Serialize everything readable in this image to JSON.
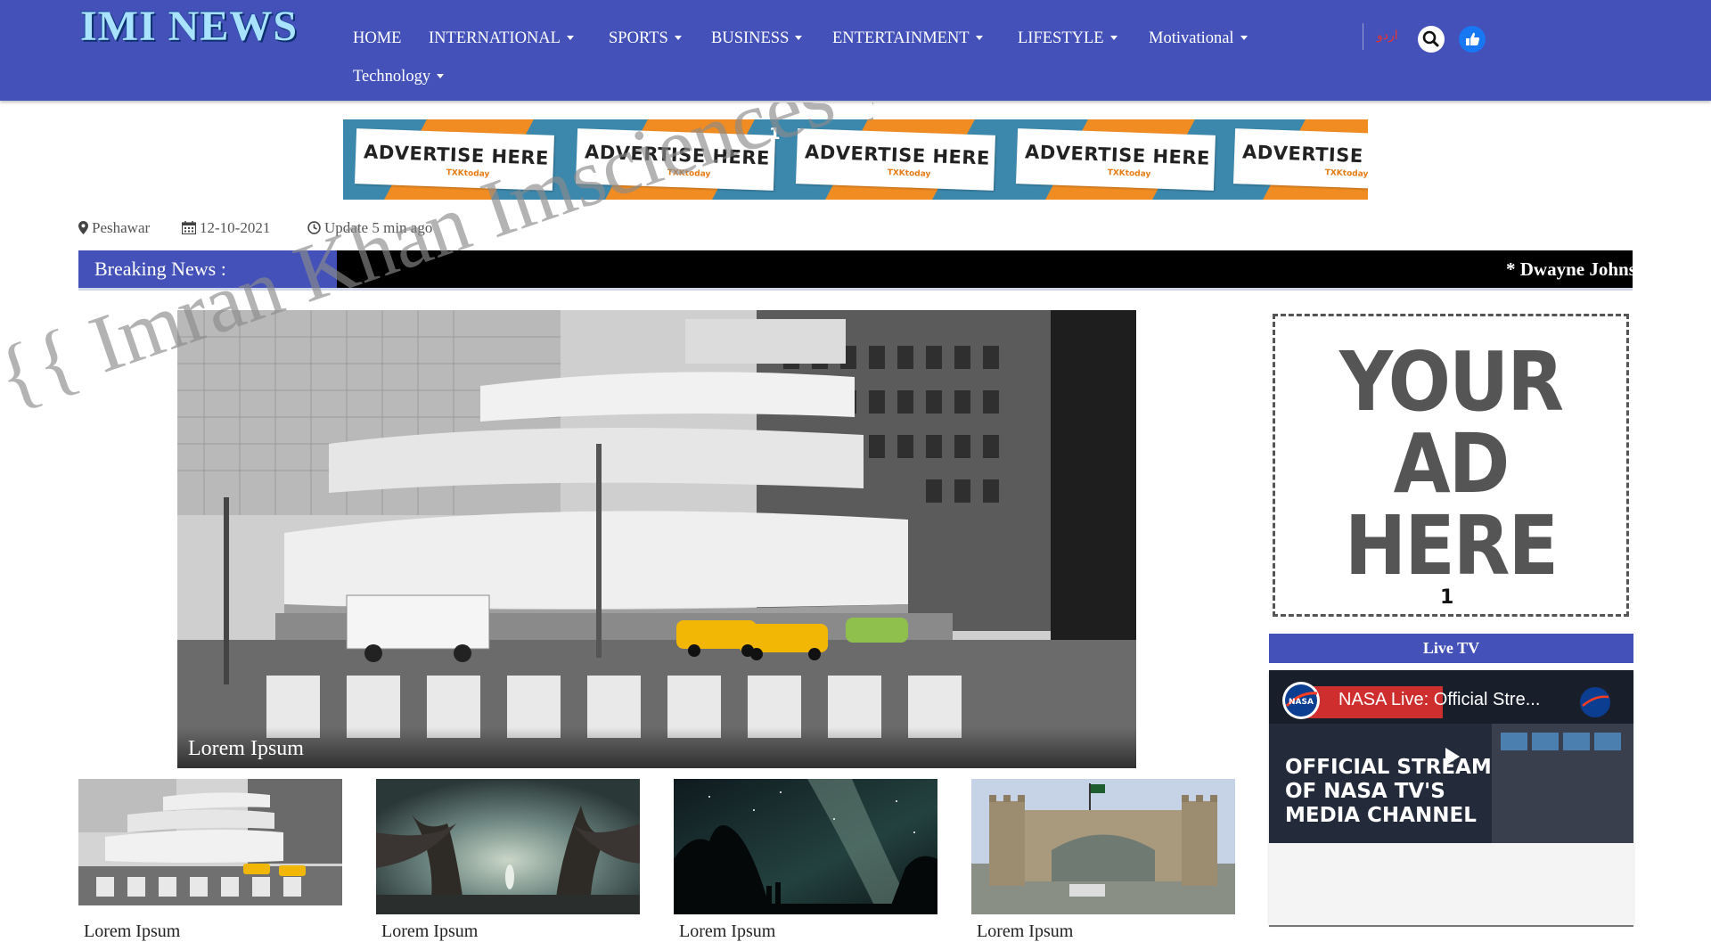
{
  "brand": {
    "logo_text": "IMI NEWS"
  },
  "nav": {
    "items": [
      {
        "label": "HOME",
        "dropdown": false
      },
      {
        "label": "INTERNATIONAL",
        "dropdown": true
      },
      {
        "label": "SPORTS",
        "dropdown": true
      },
      {
        "label": "BUSINESS",
        "dropdown": true
      },
      {
        "label": "ENTERTAINMENT",
        "dropdown": true
      },
      {
        "label": "LIFESTYLE",
        "dropdown": true
      },
      {
        "label": "Motivational",
        "dropdown": true
      },
      {
        "label": "Technology",
        "dropdown": true
      }
    ],
    "urdu_link": "اردو",
    "icons": [
      "search-icon",
      "thumbs-up-icon"
    ]
  },
  "top_ad": {
    "panel_text": "ADVERTISE HERE",
    "brand_text": "TXKtoday",
    "number": "1"
  },
  "info": {
    "location": "Peshawar",
    "date": "12-10-2021",
    "update": "Update 5 min ago"
  },
  "breaking": {
    "label": "Breaking News :",
    "ticker": "* Dwayne Johnson s"
  },
  "watermark": "{{ Imran Khan Imsciences }}",
  "hero": {
    "caption": "Lorem Ipsum"
  },
  "thumbs": [
    {
      "caption": "Lorem Ipsum",
      "image": "museum"
    },
    {
      "caption": "Lorem Ipsum",
      "image": "forest"
    },
    {
      "caption": "Lorem Ipsum",
      "image": "night-sky"
    },
    {
      "caption": "Lorem Ipsum",
      "image": "fort-gate"
    }
  ],
  "sidebar": {
    "ad_lines": [
      "YOUR",
      "AD",
      "HERE"
    ],
    "ad_number": "1",
    "live_tv": {
      "heading": "Live TV",
      "video_title": "NASA Live: Official Stre...",
      "overlay_lines": [
        "OFFICIAL STREAM",
        "OF NASA TV'S",
        "MEDIA CHANNEL"
      ],
      "banner_text": "NASA LIVE",
      "channel_logo": "NASA"
    }
  },
  "colors": {
    "nav_bg": "#4451b9",
    "logo": "#a8e2ff",
    "ad_orange": "#f08c22",
    "ad_blue": "#3c88ad"
  }
}
